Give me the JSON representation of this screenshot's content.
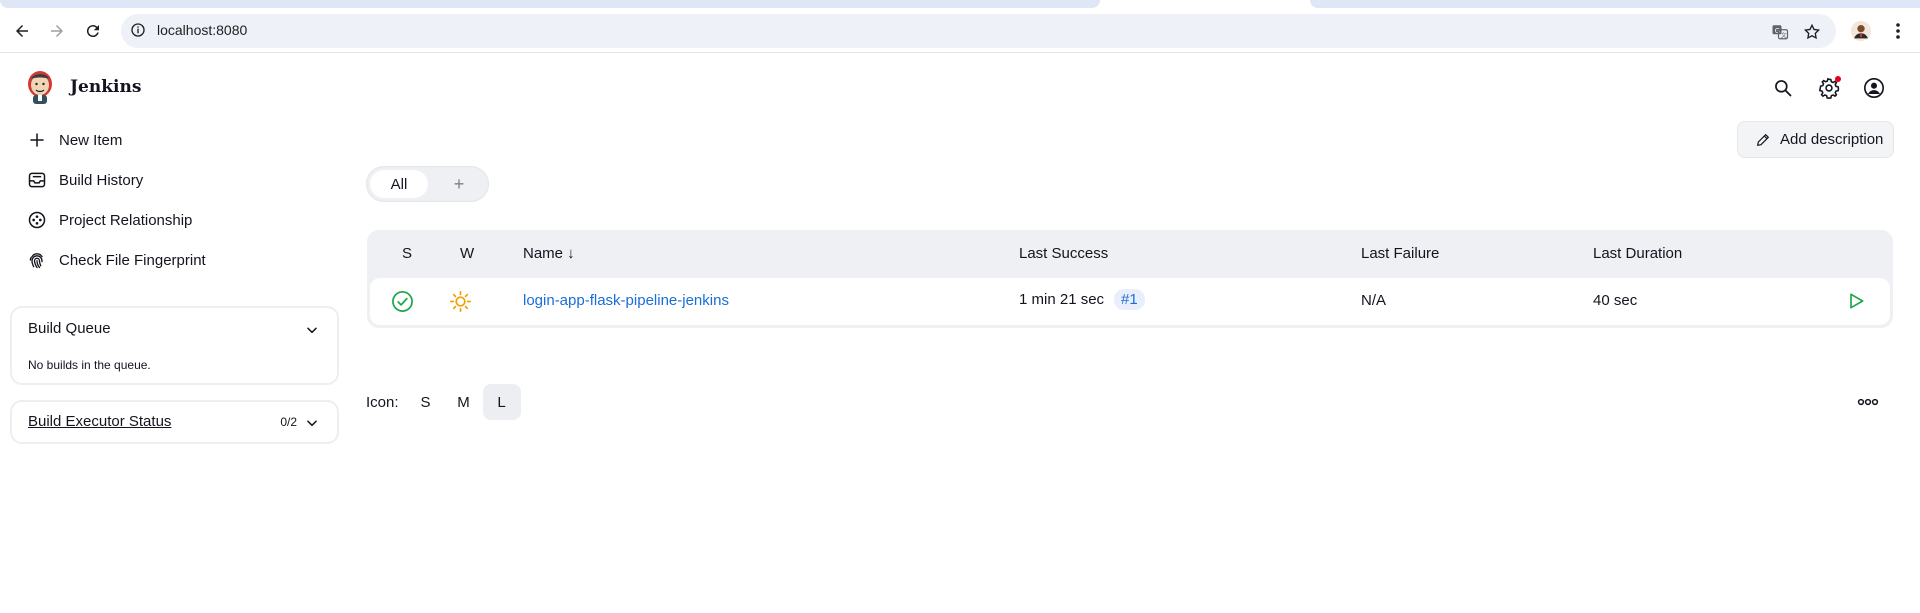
{
  "browser": {
    "url": "localhost:8080"
  },
  "app": {
    "brand": "Jenkins"
  },
  "sidebar": {
    "tasks": [
      {
        "label": "New Item",
        "icon": "plus-icon"
      },
      {
        "label": "Build History",
        "icon": "inbox-icon"
      },
      {
        "label": "Project Relationship",
        "icon": "relationship-icon"
      },
      {
        "label": "Check File Fingerprint",
        "icon": "fingerprint-icon"
      }
    ],
    "build_queue": {
      "title": "Build Queue",
      "empty_text": "No builds in the queue."
    },
    "executor": {
      "title": "Build Executor Status",
      "count": "0/2"
    }
  },
  "main": {
    "add_description": "Add description",
    "view_tabs": {
      "all": "All",
      "add": "+"
    },
    "table": {
      "headers": {
        "s": "S",
        "w": "W",
        "name": "Name ↓",
        "last_success": "Last Success",
        "last_failure": "Last Failure",
        "last_duration": "Last Duration"
      },
      "rows": [
        {
          "status": "success",
          "weather": "sunny",
          "name": "login-app-flask-pipeline-jenkins",
          "last_success": "1 min 21 sec",
          "last_success_build": "#1",
          "last_failure": "N/A",
          "last_duration": "40 sec"
        }
      ]
    },
    "icon_size": {
      "label": "Icon:",
      "options": [
        "S",
        "M",
        "L"
      ],
      "selected": "L"
    }
  },
  "colors": {
    "link": "#1a6ed8",
    "success": "#1ea64b",
    "sunny": "#f0a000",
    "notification": "#e6001f"
  }
}
